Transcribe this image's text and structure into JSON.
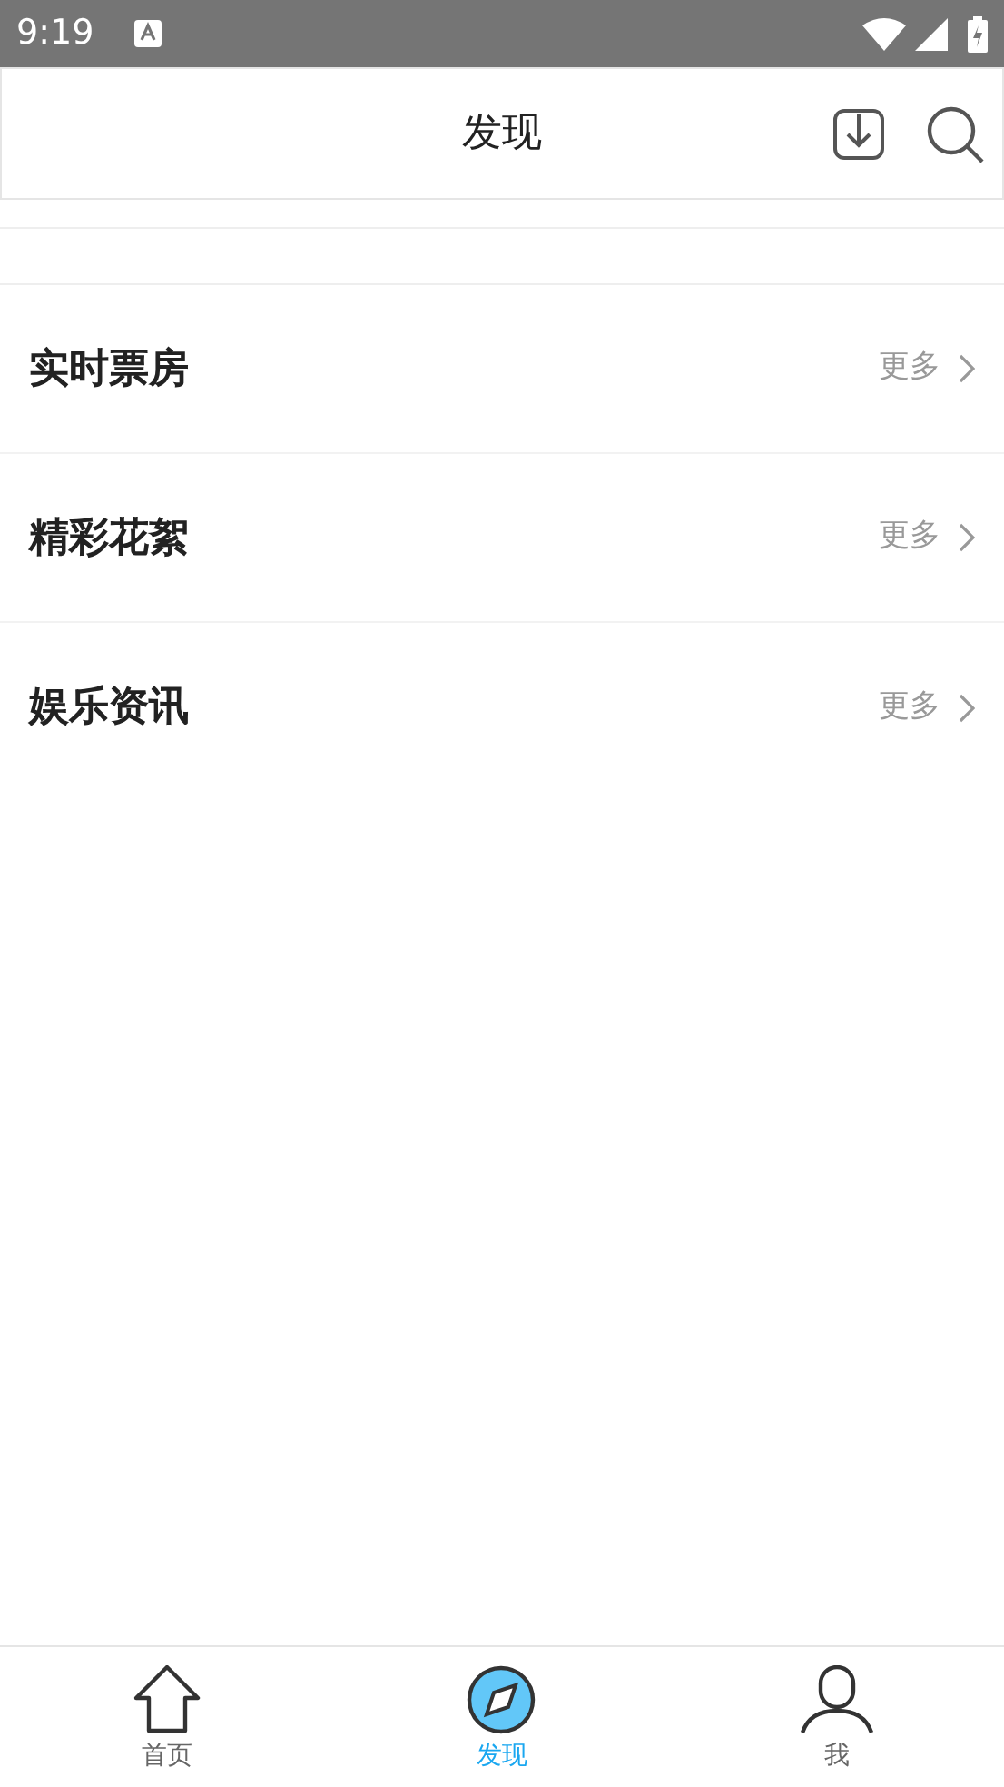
{
  "status_bar": {
    "time": "9:19"
  },
  "header": {
    "title": "发现"
  },
  "sections": [
    {
      "title": "实时票房",
      "more": "更多"
    },
    {
      "title": "精彩花絮",
      "more": "更多"
    },
    {
      "title": "娱乐资讯",
      "more": "更多"
    }
  ],
  "tabs": [
    {
      "kind": "home",
      "label": "首页",
      "selected": false
    },
    {
      "kind": "discover",
      "label": "发现",
      "selected": true
    },
    {
      "kind": "me",
      "label": "我",
      "selected": false
    }
  ]
}
